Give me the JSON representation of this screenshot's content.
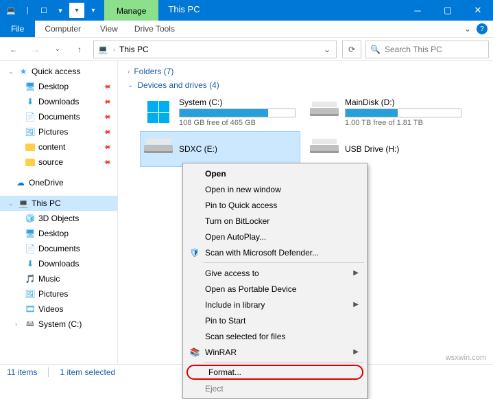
{
  "titlebar": {
    "manage": "Manage",
    "drive_tools": "Drive Tools",
    "title": "This PC"
  },
  "ribbon": {
    "file": "File",
    "computer": "Computer",
    "view": "View"
  },
  "nav": {
    "breadcrumb": "This PC",
    "search_placeholder": "Search This PC"
  },
  "sidebar": {
    "quick_access": "Quick access",
    "desktop": "Desktop",
    "downloads": "Downloads",
    "documents": "Documents",
    "pictures": "Pictures",
    "content": "content",
    "source": "source",
    "onedrive": "OneDrive",
    "this_pc": "This PC",
    "objects_3d": "3D Objects",
    "desktop2": "Desktop",
    "documents2": "Documents",
    "downloads2": "Downloads",
    "music": "Music",
    "pictures2": "Pictures",
    "videos": "Videos",
    "system_c": "System (C:)"
  },
  "main": {
    "folders_head": "Folders (7)",
    "drives_head": "Devices and drives (4)",
    "drives": [
      {
        "name": "System (C:)",
        "free": "108 GB free of 465 GB",
        "pct": 77
      },
      {
        "name": "MainDisk (D:)",
        "free": "1.00 TB free of 1.81 TB",
        "pct": 45
      },
      {
        "name": "SDXC (E:)",
        "free": "",
        "pct": 0
      },
      {
        "name": "USB Drive (H:)",
        "free": "",
        "pct": 0
      }
    ]
  },
  "ctx": {
    "open": "Open",
    "open_new": "Open in new window",
    "pin_quick": "Pin to Quick access",
    "bitlocker": "Turn on BitLocker",
    "autoplay": "Open AutoPlay...",
    "defender": "Scan with Microsoft Defender...",
    "give_access": "Give access to",
    "portable": "Open as Portable Device",
    "include_lib": "Include in library",
    "pin_start": "Pin to Start",
    "scan_sel": "Scan selected for files",
    "winrar": "WinRAR",
    "format": "Format...",
    "eject": "Eject"
  },
  "status": {
    "count": "11 items",
    "selected": "1 item selected"
  },
  "watermark": "wsxwin.com"
}
